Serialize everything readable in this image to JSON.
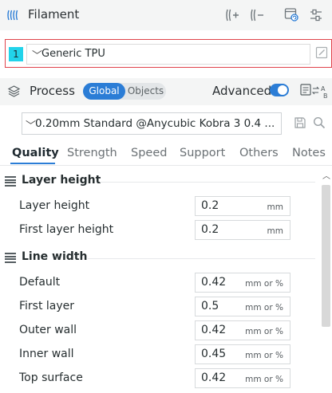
{
  "filament": {
    "title": "Filament",
    "slot_number": "1",
    "selected": "Generic TPU"
  },
  "process": {
    "title": "Process",
    "segment": {
      "global": "Global",
      "objects": "Objects",
      "active": "Global"
    },
    "advanced_label": "Advanced",
    "advanced_on": true,
    "preset": "0.20mm Standard @Anycubic Kobra 3 0.4 ..."
  },
  "tabs": [
    {
      "label": "Quality",
      "active": true
    },
    {
      "label": "Strength",
      "active": false
    },
    {
      "label": "Speed",
      "active": false
    },
    {
      "label": "Support",
      "active": false
    },
    {
      "label": "Others",
      "active": false
    },
    {
      "label": "Notes",
      "active": false
    }
  ],
  "sections": {
    "layer_height": {
      "title": "Layer height",
      "options": [
        {
          "label": "Layer height",
          "value": "0.2",
          "unit": "mm"
        },
        {
          "label": "First layer height",
          "value": "0.2",
          "unit": "mm"
        }
      ]
    },
    "line_width": {
      "title": "Line width",
      "options": [
        {
          "label": "Default",
          "value": "0.42",
          "unit": "mm or %"
        },
        {
          "label": "First layer",
          "value": "0.5",
          "unit": "mm or %"
        },
        {
          "label": "Outer wall",
          "value": "0.42",
          "unit": "mm or %"
        },
        {
          "label": "Inner wall",
          "value": "0.45",
          "unit": "mm or %"
        },
        {
          "label": "Top surface",
          "value": "0.42",
          "unit": "mm or %"
        }
      ]
    }
  },
  "colors": {
    "accent": "#2b7dd6",
    "slot_color": "#22d3ea",
    "highlight_border": "#e0434b"
  },
  "icons": {
    "filament": "filament-spool-icon",
    "add_filament": "add-filament-icon",
    "remove_filament": "remove-filament-icon",
    "sync": "sync-settings-icon",
    "settings": "sliders-icon",
    "process": "layers-icon",
    "compare": "compare-presets-icon",
    "save": "save-icon",
    "search": "search-icon",
    "edit": "edit-icon"
  }
}
